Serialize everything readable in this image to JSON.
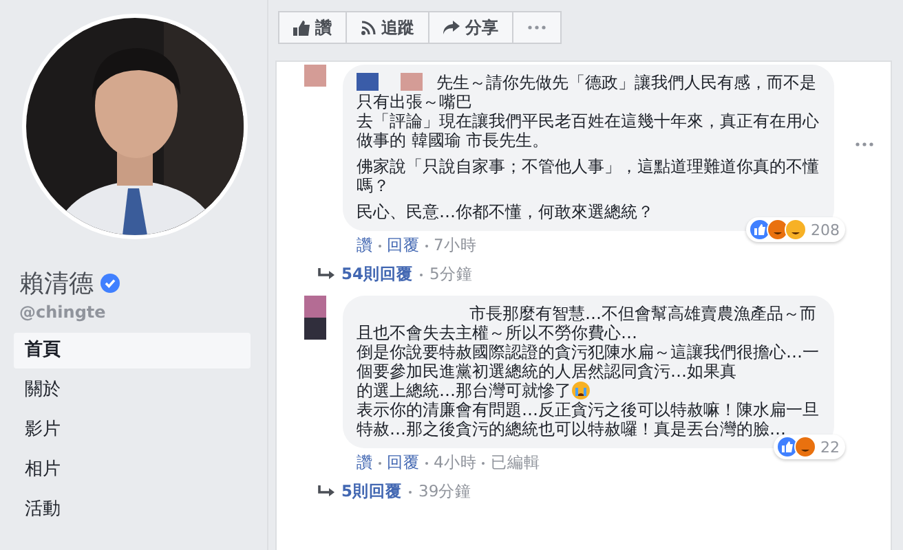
{
  "profile": {
    "name": "賴清德",
    "verified": true,
    "handle": "@chingte"
  },
  "nav": [
    {
      "label": "首頁",
      "selected": true
    },
    {
      "label": "關於",
      "selected": false
    },
    {
      "label": "影片",
      "selected": false
    },
    {
      "label": "相片",
      "selected": false
    },
    {
      "label": "活動",
      "selected": false
    }
  ],
  "page_actions": [
    {
      "kind": "like",
      "label": "讚"
    },
    {
      "kind": "follow",
      "label": "追蹤"
    },
    {
      "kind": "share",
      "label": "分享"
    },
    {
      "kind": "more"
    }
  ],
  "comments": [
    {
      "redacted": true,
      "paragraphs": [
        [
          {
            "text": "先生～請你先做先「德政」讓我們人民有感，而不是只有出張～嘴巴"
          },
          {
            "text": "去「評論」現在讓我們平民老百姓在這幾十年來，真正有在用心做事的 韓國瑜 市長先生。"
          }
        ],
        [
          {
            "text": "佛家說「只說自家事；不管他人事」，這點道理難道你真的不懂嗎？"
          }
        ],
        [
          {
            "text": "民心、民意…你都不懂，何敢來選總統？"
          }
        ]
      ],
      "reactions": [
        {
          "kind": "like"
        },
        {
          "kind": "angry"
        },
        {
          "kind": "haha"
        }
      ],
      "reaction_count": "208",
      "menu": true,
      "actions": [
        "讚",
        "回覆",
        "7小時"
      ],
      "replies": {
        "label": "54則回覆",
        "time": "5分鐘"
      }
    },
    {
      "redacted": false,
      "paragraphs": [
        [
          {
            "text": "市長那麼有智慧…不但會幫高雄賣農漁產品～而且也不會失去主權～所以不勞你費心…"
          },
          {
            "text": "倒是你說要特赦國際認證的貪污犯陳水扁～這讓我們很擔心…一個要參加民進黨初選總統的人居然認同貪污…如果真"
          },
          {
            "text": "的選上總統…那台灣可就慘了",
            "crying": true
          },
          {
            "text": "表示你的清廉會有問題…反正貪污之後可以特赦嘛！陳水扁一旦特赦…那之後貪污的總統也可以特赦囉！真是丟台灣的臉…"
          }
        ]
      ],
      "reactions": [
        {
          "kind": "like"
        },
        {
          "kind": "angry"
        }
      ],
      "reaction_count": "22",
      "menu": false,
      "actions": [
        "讚",
        "回覆",
        "4小時",
        "已編輯"
      ],
      "replies": {
        "label": "5則回覆",
        "time": "39分鐘"
      }
    }
  ]
}
